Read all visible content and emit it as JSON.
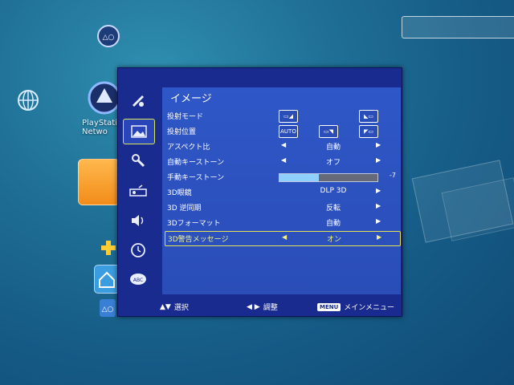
{
  "background": {
    "playstation_label": "PlayStati\nNetwo"
  },
  "osd": {
    "title": "イメージ",
    "sidebar_icons": [
      "picture-adjust-icon",
      "image-icon",
      "settings-tools-icon",
      "projector-icon",
      "speaker-icon",
      "clock-icon",
      "speech-abc-icon"
    ],
    "rows": [
      {
        "label": "投射モード",
        "type": "icons",
        "icons": [
          "front-table-icon",
          "rear-table-icon"
        ]
      },
      {
        "label": "投射位置",
        "type": "icons",
        "icons": [
          "auto-icon",
          "front-ceiling-icon",
          "rear-ceiling-icon"
        ],
        "auto_text": "AUTO"
      },
      {
        "label": "アスペクト比",
        "type": "select",
        "value": "自動"
      },
      {
        "label": "自動キーストーン",
        "type": "select",
        "value": "オフ"
      },
      {
        "label": "手動キーストーン",
        "type": "slider",
        "value": "-7",
        "level": 0.4
      },
      {
        "label": "3D眼鏡",
        "type": "submenu",
        "value": "DLP 3D"
      },
      {
        "label": "3D 逆同期",
        "type": "submenu",
        "value": "反転"
      },
      {
        "label": "3Dフォーマット",
        "type": "submenu",
        "value": "自動"
      },
      {
        "label": "3D警告メッセージ",
        "type": "select",
        "value": "オン",
        "selected": true
      }
    ],
    "bottom": {
      "select_hint": "選択",
      "adjust_hint": "調整",
      "menu_badge": "MENU",
      "main_menu_hint": "メインメニュー"
    }
  },
  "colors": {
    "panel_bg": "#1a2b8f",
    "content_bg": "#2f57c7",
    "highlight": "#e7e25c"
  }
}
